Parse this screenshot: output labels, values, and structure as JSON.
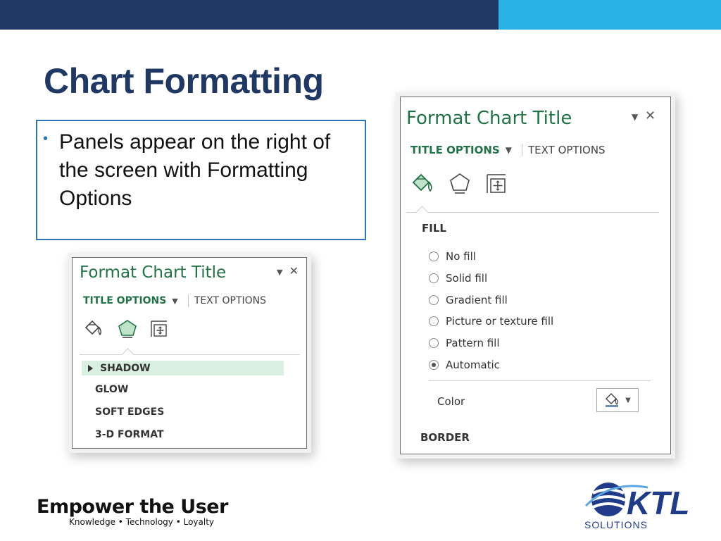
{
  "slide": {
    "title": "Chart Formatting",
    "bullet": "Panels appear on the right of the screen with Formatting Options",
    "colors": {
      "header_dark": "#1f3864",
      "header_accent": "#29b2e6",
      "panel_green": "#217346"
    }
  },
  "panel_small": {
    "title": "Format Chart Title",
    "tab_active": "TITLE OPTIONS",
    "tab_inactive": "TEXT OPTIONS",
    "icons": [
      "fill-line-icon",
      "effects-icon",
      "size-properties-icon"
    ],
    "selected_icon": "effects-icon",
    "sections": [
      {
        "label": "SHADOW",
        "expanded": false,
        "highlighted": true
      },
      {
        "label": "GLOW",
        "expanded": false,
        "highlighted": false
      },
      {
        "label": "SOFT EDGES",
        "expanded": false,
        "highlighted": false
      },
      {
        "label": "3-D FORMAT",
        "expanded": false,
        "highlighted": false
      }
    ]
  },
  "panel_large": {
    "title": "Format Chart Title",
    "tab_active": "TITLE OPTIONS",
    "tab_inactive": "TEXT OPTIONS",
    "icons": [
      "fill-line-icon",
      "effects-icon",
      "size-properties-icon"
    ],
    "selected_icon": "fill-line-icon",
    "fill_section": "FILL",
    "fill_options": [
      {
        "label": "No fill",
        "selected": false
      },
      {
        "label": "Solid fill",
        "selected": false
      },
      {
        "label": "Gradient fill",
        "selected": false
      },
      {
        "label": "Picture or texture fill",
        "selected": false
      },
      {
        "label": "Pattern fill",
        "selected": false
      },
      {
        "label": "Automatic",
        "selected": true
      }
    ],
    "color_label": "Color",
    "border_section": "BORDER"
  },
  "logos": {
    "left_brand": "Empower the User",
    "left_tagline": "Knowledge • Technology • Loyalty",
    "right_brand": "KTL",
    "right_sub": "SOLUTIONS"
  }
}
